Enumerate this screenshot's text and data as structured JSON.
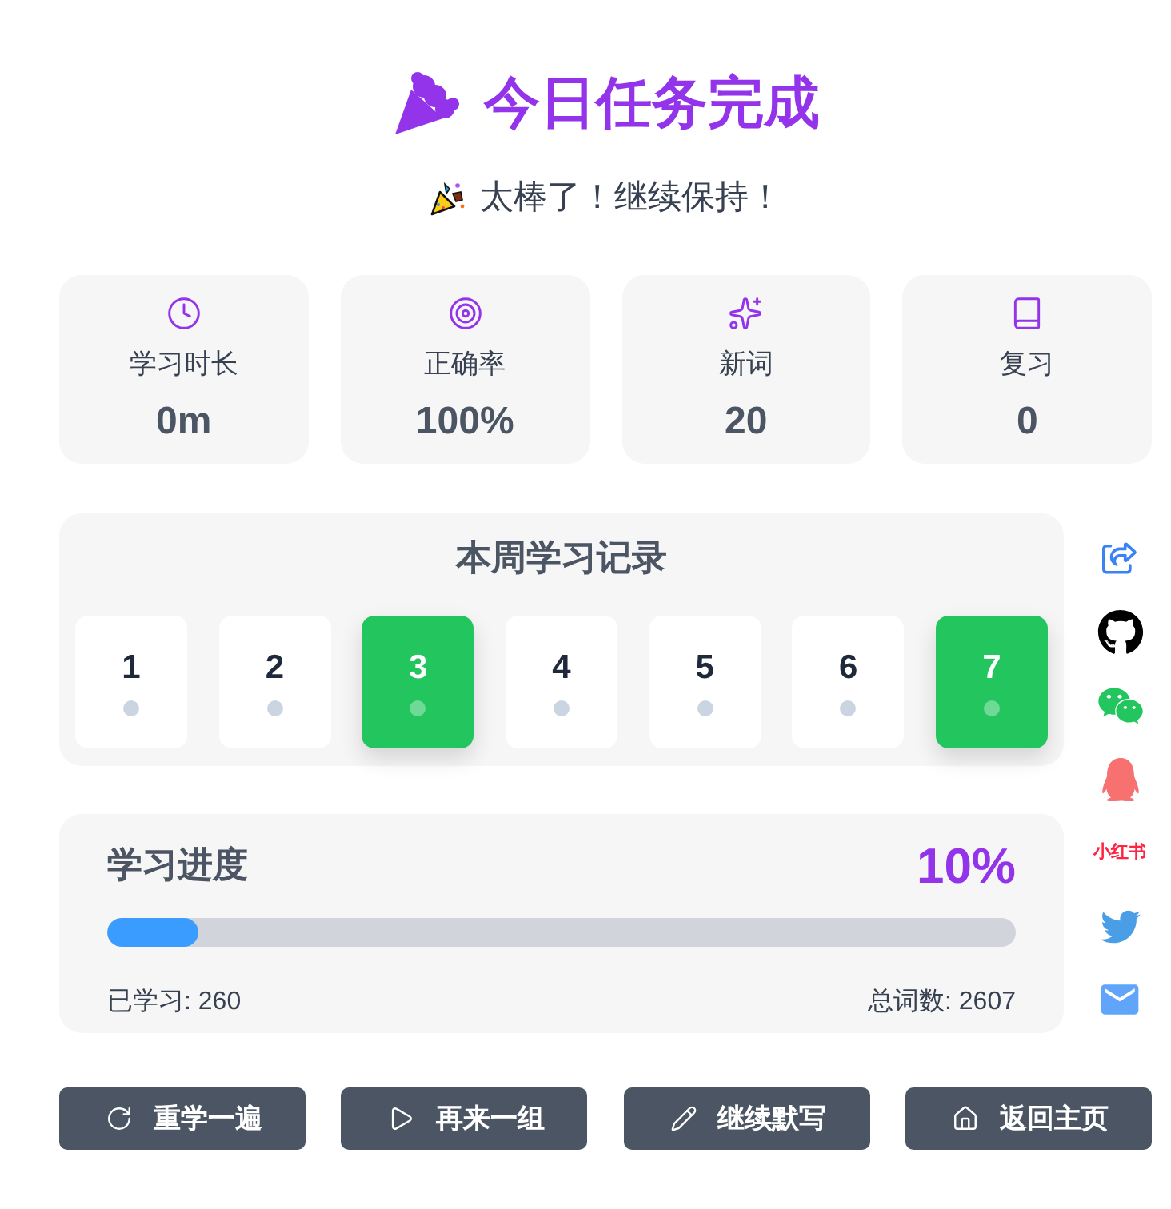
{
  "header": {
    "title": "今日任务完成",
    "subtitle": "太棒了！继续保持！"
  },
  "stats": [
    {
      "label": "学习时长",
      "value": "0m"
    },
    {
      "label": "正确率",
      "value": "100%"
    },
    {
      "label": "新词",
      "value": "20"
    },
    {
      "label": "复习",
      "value": "0"
    }
  ],
  "week": {
    "title": "本周学习记录",
    "days": [
      {
        "label": "1",
        "done": false
      },
      {
        "label": "2",
        "done": false
      },
      {
        "label": "3",
        "done": true
      },
      {
        "label": "4",
        "done": false
      },
      {
        "label": "5",
        "done": false
      },
      {
        "label": "6",
        "done": false
      },
      {
        "label": "7",
        "done": true
      }
    ]
  },
  "progress": {
    "title": "学习进度",
    "percent": "10%",
    "level": 0.1,
    "learned": "已学习: 260",
    "total": "总词数: 2607"
  },
  "share_links": [
    {
      "kind": "share"
    },
    {
      "kind": "github"
    },
    {
      "kind": "wechat"
    },
    {
      "kind": "qq"
    },
    {
      "kind": "text",
      "label": "小红书"
    },
    {
      "kind": "twitter"
    },
    {
      "kind": "mail"
    }
  ],
  "actions": [
    {
      "label": "重学一遍"
    },
    {
      "label": "再来一组"
    },
    {
      "label": "继续默写"
    },
    {
      "label": "返回主页"
    }
  ]
}
